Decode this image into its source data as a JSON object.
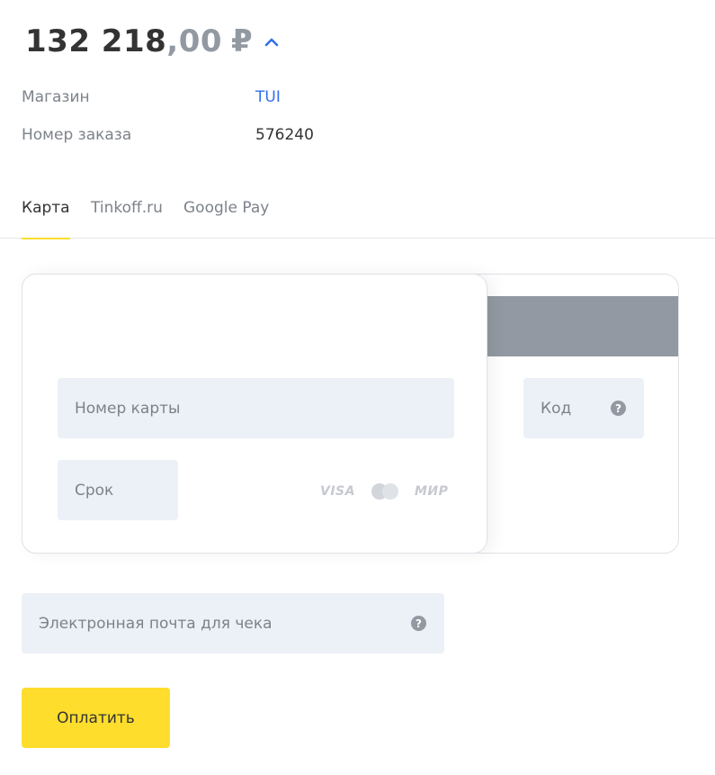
{
  "summary": {
    "amount_integer": "132 218",
    "amount_fraction": ",00",
    "currency": "₽"
  },
  "details": {
    "shop_label": "Магазин",
    "shop_value": "TUI",
    "order_label": "Номер заказа",
    "order_value": "576240"
  },
  "tabs": [
    {
      "label": "Карта",
      "active": true
    },
    {
      "label": "Tinkoff.ru",
      "active": false
    },
    {
      "label": "Google Pay",
      "active": false
    }
  ],
  "card": {
    "number_placeholder": "Номер карты",
    "expiry_placeholder": "Срок",
    "cvc_placeholder": "Код",
    "help_glyph": "?",
    "brands": [
      "VISA",
      "МИР"
    ]
  },
  "email": {
    "placeholder": "Электронная почта для чека",
    "help_glyph": "?"
  },
  "actions": {
    "pay_label": "Оплатить"
  },
  "colors": {
    "accent_yellow": "#ffdd2d",
    "link_blue": "#336fee",
    "field_bg": "#ecf0f7",
    "stripe_gray": "#9299a2"
  }
}
